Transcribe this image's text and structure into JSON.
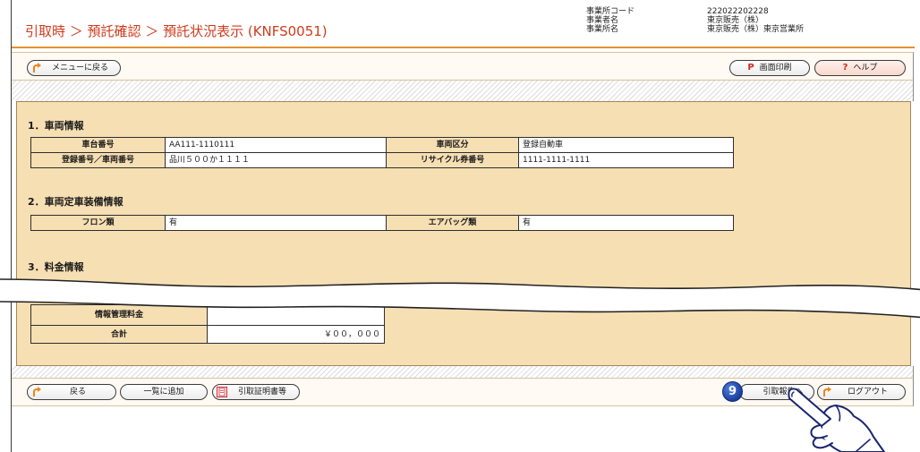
{
  "header": {
    "breadcrumb": "引取時 ＞ 預託確認 ＞ 預託状況表示 (KNFS0051)",
    "office_code_label": "事業所コード",
    "office_code": "222022202228",
    "company_label": "事業者名",
    "company": "東京販売（株）",
    "office_label": "事業所名",
    "office": "東京販売（株）東京営業所"
  },
  "top_toolbar": {
    "menu_back": "メニューに戻る",
    "print_mark": "P",
    "print": "画面印刷",
    "help_mark": "?",
    "help": "ヘルプ"
  },
  "vehicle": {
    "heading": "1．車両情報",
    "rows": [
      [
        "車台番号",
        "AA111-1110111",
        "車両区分",
        "登録自動車"
      ],
      [
        "登録番号／車両番号",
        "品川５００か１１１１",
        "リサイクル券番号",
        "1111-1111-1111"
      ]
    ]
  },
  "equipment": {
    "heading": "2．車両定車装備情報",
    "rows": [
      [
        "フロン類",
        "有",
        "エアバッグ類",
        "有"
      ]
    ]
  },
  "fees": {
    "heading": "3．料金情報",
    "rows": [
      [
        "情報管理料金",
        ""
      ],
      [
        "合計",
        "￥００，０００"
      ]
    ]
  },
  "bottom_toolbar": {
    "back": "戻る",
    "add_to_list": "一覧に追加",
    "certificate": "引取証明書等",
    "step_badge": "9",
    "report": "引取報告へ",
    "logout": "ログアウト"
  },
  "icons": {
    "menu_back": "return-arrow-icon",
    "back": "return-arrow-icon",
    "certificate": "certificate-document-icon",
    "logout": "logout-arrow-icon",
    "cursor": "pointing-hand-icon"
  },
  "colors": {
    "title": "#cf3b1d",
    "accent_rule": "#e4912f",
    "panel": "#f6dfb3",
    "badge": "#1a3f9e",
    "cursor": "#1a2570"
  }
}
